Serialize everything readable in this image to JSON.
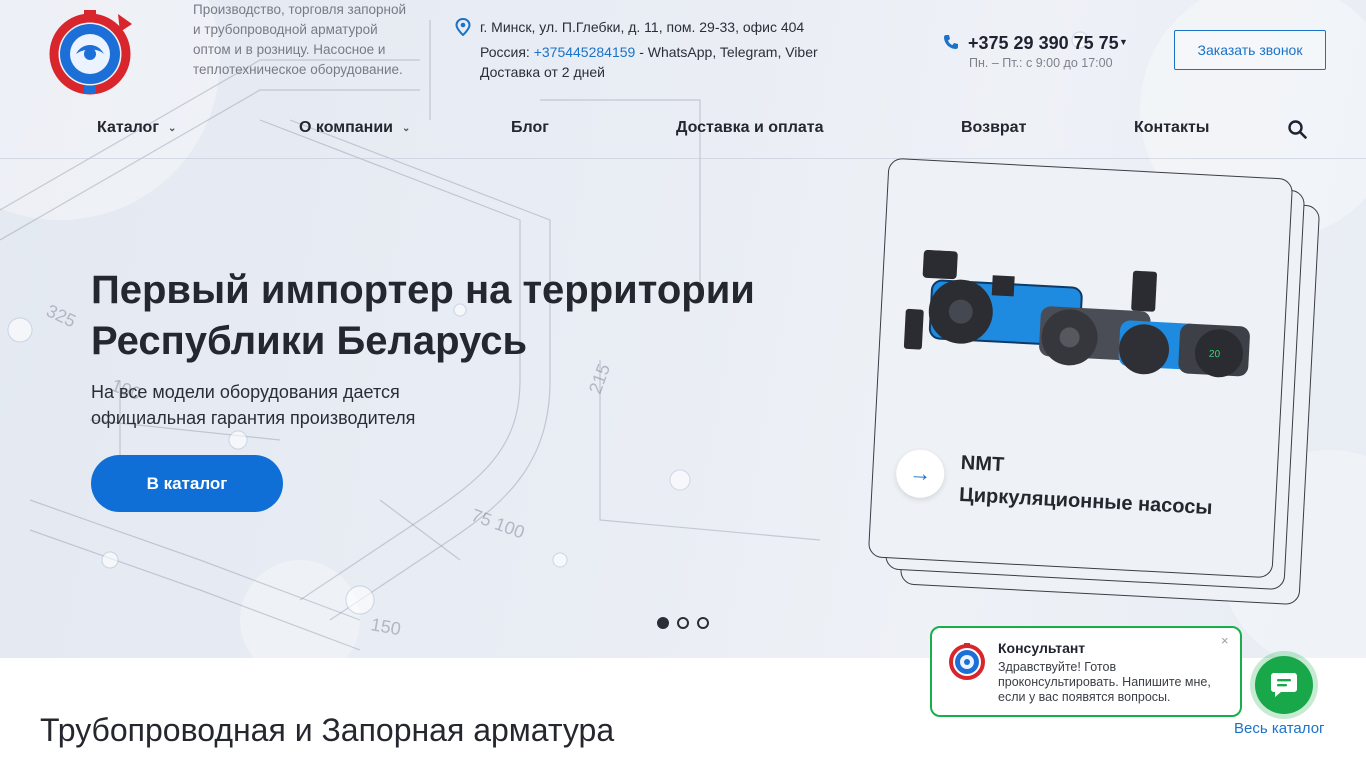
{
  "header": {
    "tagline": "Производство, торговля запорной и трубопроводной арматурой оптом и в розницу. Насосное и теплотехническое оборудование.",
    "address": "г. Минск, ул. П.Глебки, д. 11, пом. 29-33, офис 404",
    "russia_prefix": "Россия: ",
    "russia_phone": "+375445284159",
    "russia_suffix": " - WhatsApp, Telegram, Viber",
    "delivery": "Доставка от 2 дней",
    "phone": "+375 29 390 75 75",
    "hours": "Пн. – Пт.: с 9:00 до 17:00",
    "callback_label": "Заказать звонок"
  },
  "nav": {
    "items": [
      {
        "label": "Каталог"
      },
      {
        "label": "О компании"
      },
      {
        "label": "Блог"
      },
      {
        "label": "Доставка и оплата"
      },
      {
        "label": "Возврат"
      },
      {
        "label": "Контакты"
      }
    ]
  },
  "hero": {
    "title": "Первый импортер на территории Республики Беларусь",
    "subtitle": "На все модели оборудования дается официальная гарантия производителя",
    "button_label": "В каталог"
  },
  "slide_card": {
    "label_line1": "NMT",
    "label_line2": "Циркуляционные насосы",
    "arrow": "→"
  },
  "slider": {
    "total": 3,
    "active": 1
  },
  "section": {
    "title": "Трубопроводная и Запорная арматура",
    "all_link": "Весь каталог"
  },
  "chat": {
    "name": "Консультант",
    "message": "Здравствуйте! Готов проконсультировать. Напишите мне, если у вас появятся вопросы.",
    "close": "×"
  },
  "colors": {
    "accent": "#0f6fd6",
    "link": "#1a73c8",
    "chat_green": "#18a84a",
    "logo_red": "#d9262c",
    "logo_blue": "#1d6fd8"
  }
}
